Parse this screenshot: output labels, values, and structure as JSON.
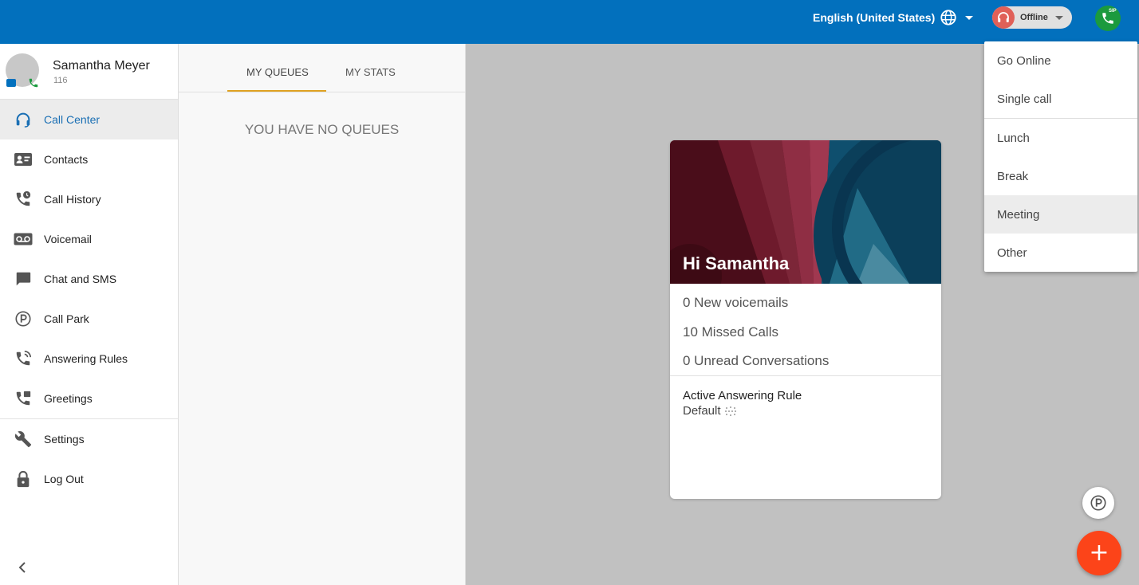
{
  "topbar": {
    "language": "English (United States)",
    "status": "Offline",
    "sip_tag": "SIP"
  },
  "profile": {
    "name": "Samantha Meyer",
    "extension": "116"
  },
  "sidebar": {
    "items": [
      {
        "label": "Call Center",
        "icon": "headset-icon",
        "active": true
      },
      {
        "label": "Contacts",
        "icon": "contact-card-icon"
      },
      {
        "label": "Call History",
        "icon": "call-history-icon"
      },
      {
        "label": "Voicemail",
        "icon": "voicemail-icon"
      },
      {
        "label": "Chat and SMS",
        "icon": "chat-icon"
      },
      {
        "label": "Call Park",
        "icon": "park-icon"
      },
      {
        "label": "Answering Rules",
        "icon": "answering-rules-icon"
      },
      {
        "label": "Greetings",
        "icon": "greetings-icon"
      }
    ],
    "bottom_items": [
      {
        "label": "Settings",
        "icon": "wrench-icon"
      },
      {
        "label": "Log Out",
        "icon": "lock-icon"
      }
    ]
  },
  "queues": {
    "tabs": [
      {
        "label": "MY QUEUES",
        "active": true
      },
      {
        "label": "MY STATS"
      }
    ],
    "empty_message": "YOU HAVE NO QUEUES"
  },
  "card": {
    "greeting": "Hi Samantha",
    "stats": [
      "0 New voicemails",
      "10 Missed Calls",
      "0 Unread Conversations"
    ],
    "rule_title": "Active Answering Rule",
    "rule_value": "Default"
  },
  "status_menu": {
    "items": [
      "Go Online",
      "Single call",
      "Lunch",
      "Break",
      "Meeting",
      "Other"
    ],
    "hovered": "Meeting"
  },
  "fab": {
    "add_label": "+"
  },
  "colors": {
    "header": "#0270bd",
    "accent_tab": "#e0a222",
    "fab_add": "#fc4419",
    "sip_green": "#1b9a3e",
    "active_link": "#1a6fb4"
  }
}
